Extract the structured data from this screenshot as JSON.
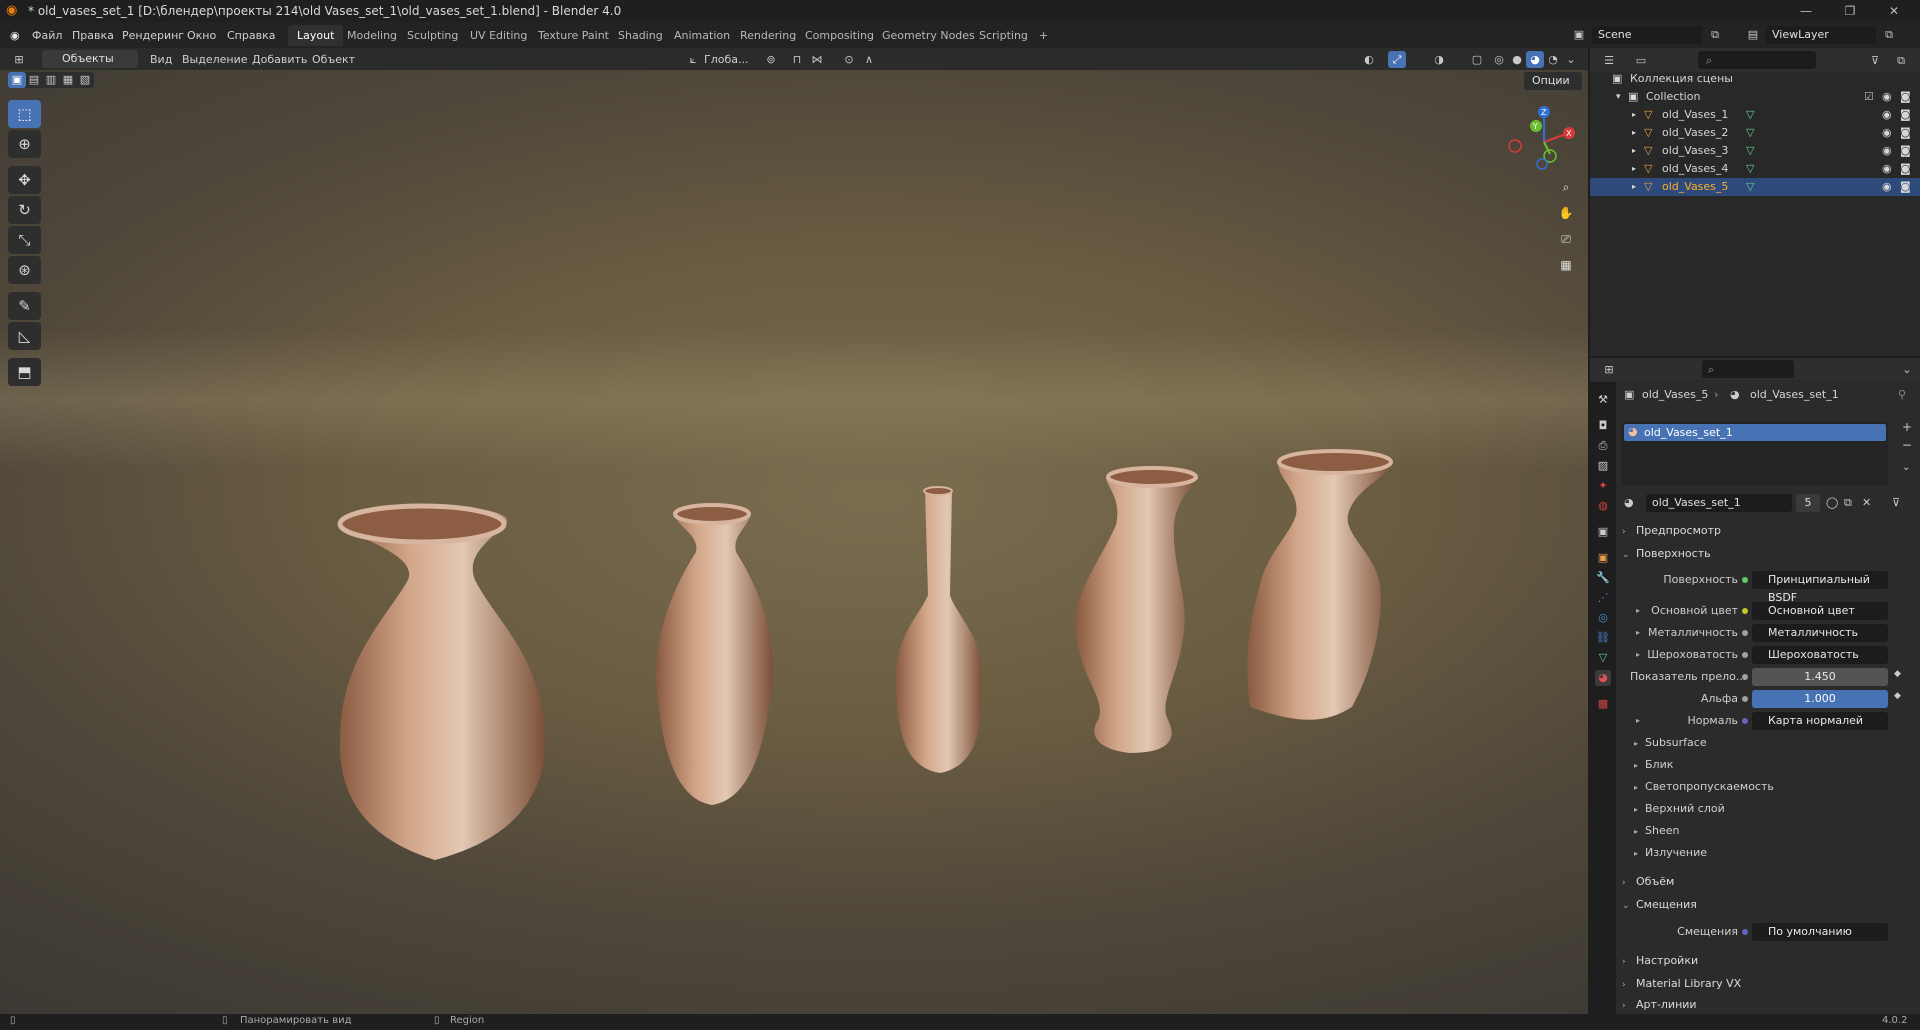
{
  "window": {
    "title": "* old_vases_set_1 [D:\\блендер\\проекты 214\\old Vases_set_1\\old_vases_set_1.blend] - Blender 4.0",
    "minimize": "—",
    "maximize": "❐",
    "close": "✕"
  },
  "menu": [
    "Файл",
    "Правка",
    "Рендеринг",
    "Окно",
    "Справка"
  ],
  "workspaces": [
    "Layout",
    "Modeling",
    "Sculpting",
    "UV Editing",
    "Texture Paint",
    "Shading",
    "Animation",
    "Rendering",
    "Compositing",
    "Geometry Nodes",
    "Scripting"
  ],
  "workspace_add": "+",
  "scene": {
    "name": "Scene",
    "view_layer": "ViewLayer"
  },
  "viewport_header": {
    "mode": "Объекты",
    "menus": [
      "Вид",
      "Выделение",
      "Добавить",
      "Объект"
    ],
    "orientation": "Глоба...",
    "options": "Опции"
  },
  "status": {
    "left_hint": "Панорамировать вид",
    "right_hint": "Region",
    "version": "4.0.2"
  },
  "outliner": {
    "scene_collection": "Коллекция сцены",
    "collection": "Collection",
    "objects": [
      "old_Vases_1",
      "old_Vases_2",
      "old_Vases_3",
      "old_Vases_4",
      "old_Vases_5"
    ],
    "active_object": "old_Vases_5"
  },
  "properties": {
    "breadcrumb_object": "old_Vases_5",
    "breadcrumb_material": "old_Vases_set_1",
    "material_slot": "old_Vases_set_1",
    "material_name": "old_Vases_set_1",
    "material_users": "5",
    "panels": {
      "preview": "Предпросмотр",
      "surface": "Поверхность",
      "volume": "Объём",
      "displacement": "Смещения",
      "settings": "Настройки",
      "material_library": "Material Library VX",
      "lineart": "Арт-линии"
    },
    "surface_rows": [
      {
        "label": "Поверхность",
        "value": "Принципиальный BSDF",
        "dot": "#63c763"
      },
      {
        "label": "Основной цвет",
        "value": "Основной цвет",
        "dot": "#c7c729"
      },
      {
        "label": "Металличность",
        "value": "Металличность",
        "dot": "#a1a1a1"
      },
      {
        "label": "Шероховатость",
        "value": "Шероховатость",
        "dot": "#a1a1a1"
      },
      {
        "label": "Показатель прело...",
        "value": "1.450",
        "dot": "#a1a1a1"
      },
      {
        "label": "Альфа",
        "value": "1.000",
        "dot": "#a1a1a1"
      },
      {
        "label": "Нормаль",
        "value": "Карта нормалей",
        "dot": "#6363c7"
      }
    ],
    "subsections": [
      "Subsurface",
      "Блик",
      "Светопропускаемость",
      "Верхний слой",
      "Sheen",
      "Излучение"
    ],
    "displacement_row": {
      "label": "Смещения",
      "value": "По умолчанию",
      "dot": "#6363c7"
    }
  },
  "colors": {
    "accent": "#4772b3",
    "active_object": "#ffaf29",
    "vase": "#b8866a"
  }
}
